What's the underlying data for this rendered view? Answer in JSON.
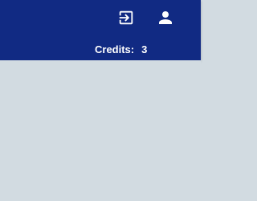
{
  "header": {
    "background_color": "#112a83",
    "login_icon": "login-icon",
    "account_icon": "account-icon",
    "credits": {
      "label": "Credits:",
      "value": "3"
    }
  },
  "main": {
    "background_color": "#d2dbe1"
  }
}
